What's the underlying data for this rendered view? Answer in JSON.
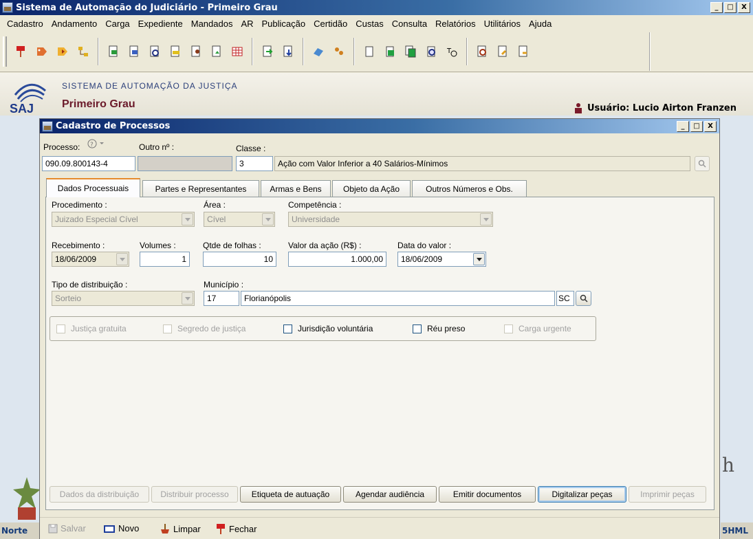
{
  "window": {
    "title": "Sistema de Automação do Judiciário - Primeiro Grau",
    "minimize": "_",
    "maximize": "□",
    "close": "X"
  },
  "menu": [
    "Cadastro",
    "Andamento",
    "Carga",
    "Expediente",
    "Mandados",
    "AR",
    "Publicação",
    "Certidão",
    "Custas",
    "Consulta",
    "Relatórios",
    "Utilitários",
    "Ajuda"
  ],
  "banner": {
    "sistema": "SISTEMA DE AUTOMAÇÃO DA JUSTIÇA",
    "grau": "Primeiro Grau",
    "saj": "SAJ",
    "user": "Usuário: Lucio Airton Franzen"
  },
  "status": {
    "left": "Norte",
    "right": "5HML"
  },
  "background": {
    "letters": "h"
  },
  "child": {
    "title": "Cadastro de Processos",
    "processo_label": "Processo:",
    "processo_value": "090.09.800143-4",
    "outro_label": "Outro nº :",
    "outro_value": "",
    "classe_label": "Classe :",
    "classe_code": "3",
    "classe_desc": "Ação com Valor Inferior a 40 Salários-Mínimos",
    "tabs": [
      "Dados Processuais",
      "Partes e Representantes",
      "Armas e Bens",
      "Objeto da Ação",
      "Outros Números e Obs."
    ],
    "procedimento_label": "Procedimento :",
    "procedimento_value": "Juizado Especial Cível",
    "area_label": "Área :",
    "area_value": "Cível",
    "competencia_label": "Competência :",
    "competencia_value": "Universidade",
    "recebimento_label": "Recebimento :",
    "recebimento_value": "18/06/2009",
    "volumes_label": "Volumes :",
    "volumes_value": "1",
    "folhas_label": "Qtde de folhas :",
    "folhas_value": "10",
    "valor_label": "Valor da ação (R$) :",
    "valor_value": "1.000,00",
    "data_valor_label": "Data do valor :",
    "data_valor_value": "18/06/2009",
    "distribuicao_label": "Tipo de distribuição :",
    "distribuicao_value": "Sorteio",
    "municipio_label": "Município :",
    "municipio_code": "17",
    "municipio_name": "Florianópolis",
    "uf": "SC",
    "flags": [
      {
        "label": "Justiça gratuita",
        "enabled": false
      },
      {
        "label": "Segredo de justiça",
        "enabled": false
      },
      {
        "label": "Jurisdição voluntária",
        "enabled": true
      },
      {
        "label": "Réu preso",
        "enabled": true
      },
      {
        "label": "Carga urgente",
        "enabled": false
      }
    ],
    "buttons": {
      "dados_distribuicao": "Dados da distribuição",
      "distribuir": "Distribuir processo",
      "etiqueta": "Etiqueta de autuação",
      "agendar": "Agendar audiência",
      "emitir": "Emitir documentos",
      "digitalizar": "Digitalizar peças",
      "imprimir": "Imprimir peças"
    },
    "bottom": {
      "salvar": "Salvar",
      "novo": "Novo",
      "limpar": "Limpar",
      "fechar": "Fechar"
    }
  },
  "colors": {
    "title_bar": "#0a246a",
    "grau_text": "#6b1a2a",
    "active_tab_accent": "#e68b2c"
  }
}
